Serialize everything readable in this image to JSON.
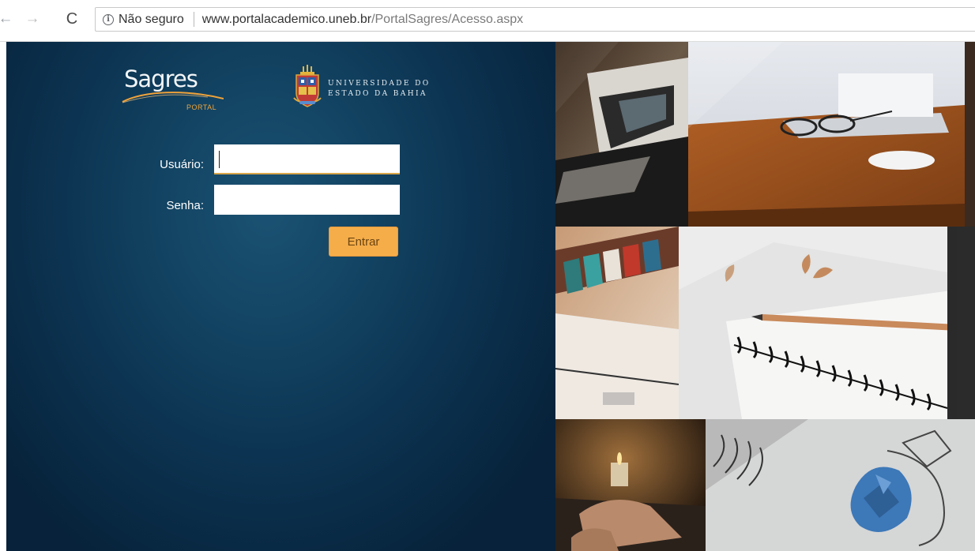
{
  "browser": {
    "back_icon": "arrow-back-icon",
    "forward_icon": "arrow-forward-icon",
    "reload_icon": "reload-icon",
    "security_icon": "info-circle-icon",
    "security_label": "Não seguro",
    "url_host": "www.portalacademico.uneb.br",
    "url_path": "/PortalSagres/Acesso.aspx"
  },
  "brand": {
    "sagres_word": "Sagres",
    "sagres_sub": "PORTAL",
    "university_line1": "UNIVERSIDADE DO",
    "university_line2": "ESTADO DA BAHIA",
    "accent_color": "#f5ad4a",
    "panel_color": "#0c3452"
  },
  "login": {
    "user_label": "Usuário:",
    "user_value": "",
    "password_label": "Senha:",
    "password_value": "",
    "submit_label": "Entrar"
  },
  "collage": {
    "tiles": [
      "magazines-photo",
      "laptop-glasses-photo",
      "books-photo",
      "notebook-pencil-photo",
      "candle-typing-photo",
      "paper-ball-sketch-photo"
    ]
  }
}
